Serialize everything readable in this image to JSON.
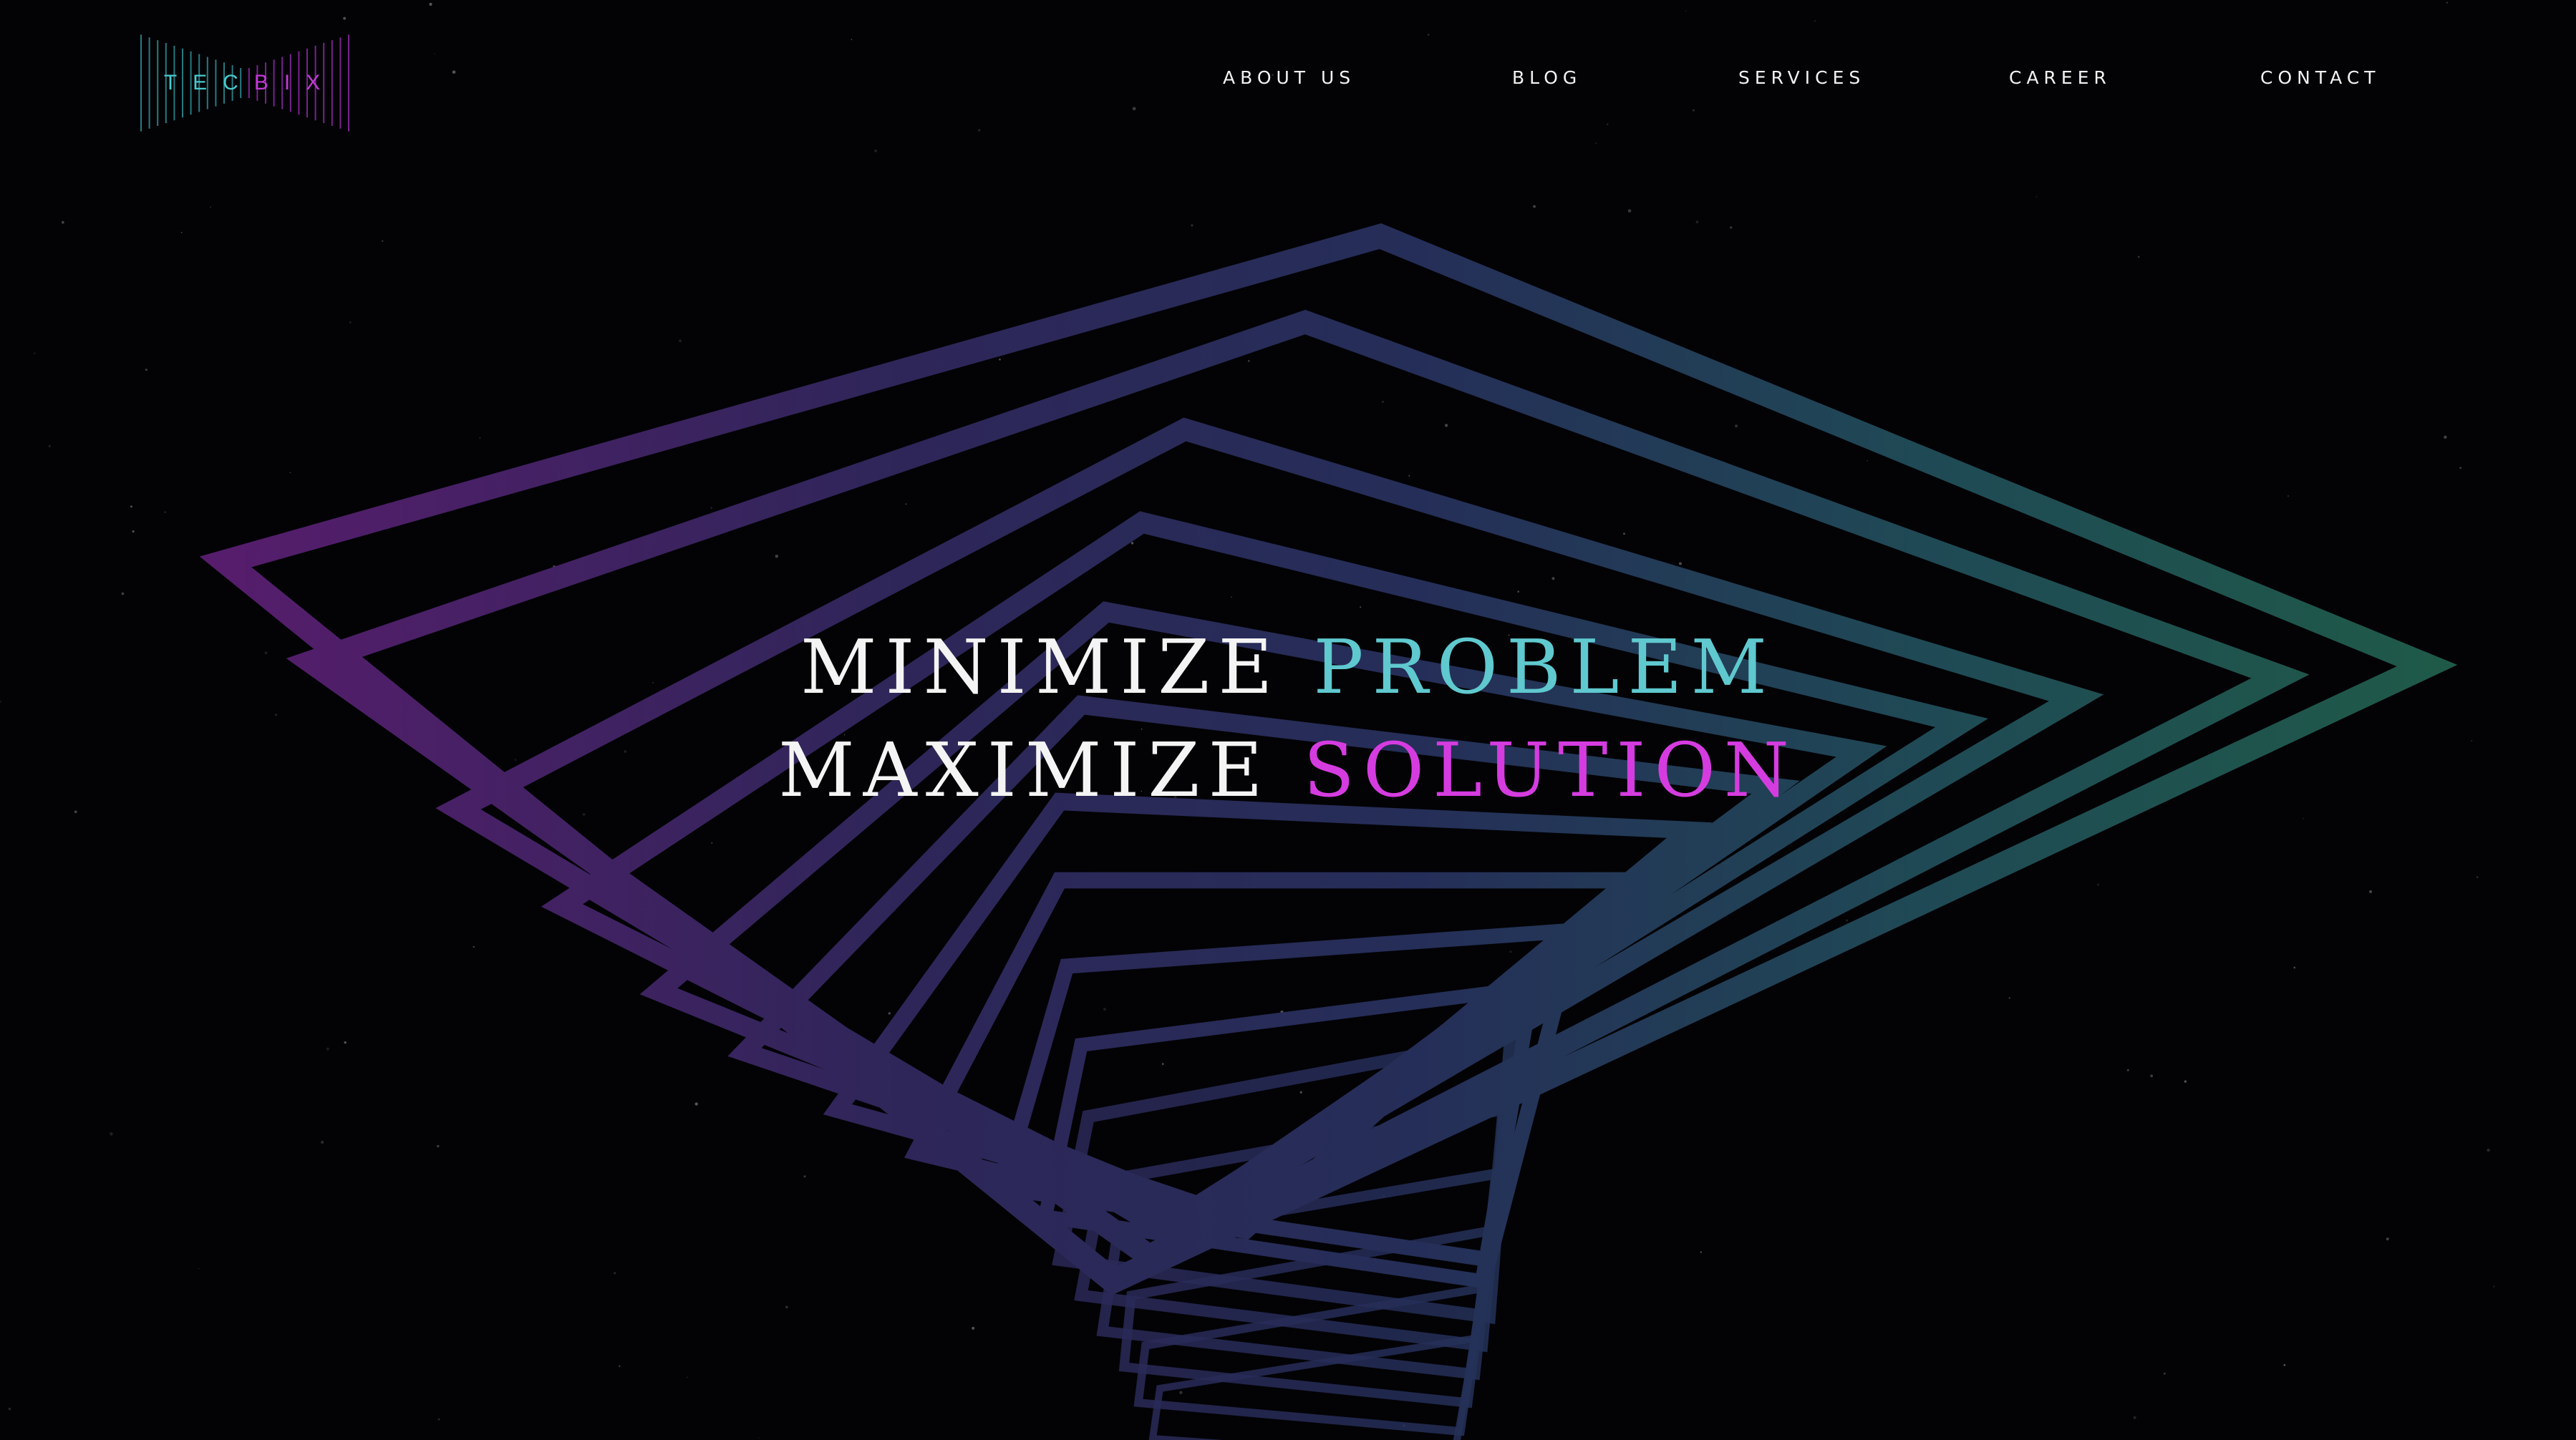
{
  "brand": {
    "logo_text_a": "TEC",
    "logo_text_b": "BIX",
    "logo_icon": "bowtie-lines-logo"
  },
  "nav": {
    "items": [
      {
        "label": "ABOUT US"
      },
      {
        "label": "BLOG"
      },
      {
        "label": "SERVICES"
      },
      {
        "label": "CAREER"
      },
      {
        "label": "CONTACT"
      }
    ]
  },
  "hero": {
    "line1_a": "MINIMIZE",
    "line1_b": "PROBLEM",
    "line2_a": "MAXIMIZE",
    "line2_b": "SOLUTION",
    "background_graphic": "twisted-square-vortex"
  },
  "colors": {
    "background": "#030306",
    "text": "#f4f4f4",
    "accent_teal": "#5fc9cf",
    "accent_magenta": "#d53ce0",
    "gradient_purple": "#5a1c6e",
    "gradient_navy": "#252a55",
    "gradient_teal": "#1f5a4c"
  }
}
